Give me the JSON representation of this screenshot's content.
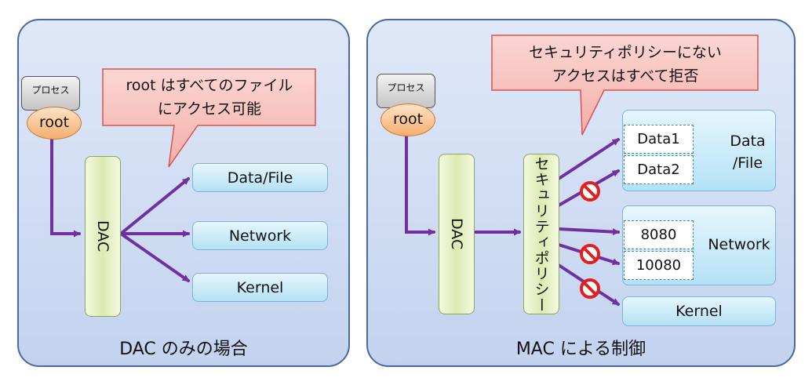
{
  "left_panel": {
    "caption": "DAC のみの場合",
    "process_label": "プロセス",
    "root_label": "root",
    "dac_label": "DAC",
    "callout_line1": "root はすべてのファイル",
    "callout_line2": "にアクセス可能",
    "targets": [
      "Data/File",
      "Network",
      "Kernel"
    ]
  },
  "right_panel": {
    "caption": "MAC による制御",
    "process_label": "プロセス",
    "root_label": "root",
    "dac_label": "DAC",
    "policy_label": "セキュリティポリシー",
    "callout_line1": "セキュリティポリシーにない",
    "callout_line2": "アクセスはすべて拒否",
    "data_group": {
      "label_line1": "Data",
      "label_line2": "/File",
      "items": [
        "Data1",
        "Data2"
      ]
    },
    "network_group": {
      "label": "Network",
      "items": [
        "8080",
        "10080"
      ]
    },
    "kernel_label": "Kernel"
  },
  "colors": {
    "arrow": "#7030a0",
    "callout_fill": "#f8c9c6",
    "callout_border": "#d9534f",
    "deny_icon": "#e02020"
  }
}
